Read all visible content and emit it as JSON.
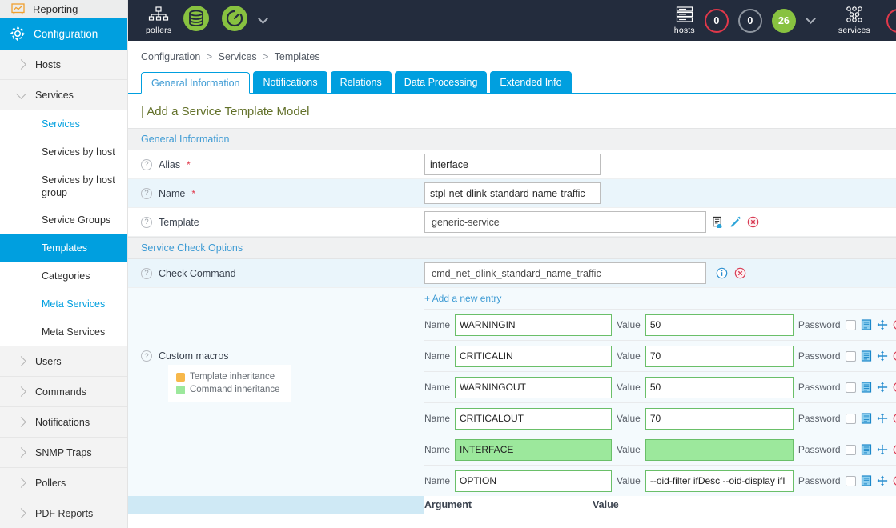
{
  "sidebar": {
    "top_item": {
      "label": "Reporting",
      "icon": "reporting-chart-icon"
    },
    "main_item": {
      "label": "Configuration",
      "icon": "gear-icon"
    },
    "groups": [
      {
        "label": "Hosts",
        "expanded": false
      },
      {
        "label": "Services",
        "expanded": true
      }
    ],
    "sub_items": [
      {
        "label": "Services",
        "state": "link"
      },
      {
        "label": "Services by host",
        "state": "normal"
      },
      {
        "label": "Services by host group",
        "state": "normal"
      },
      {
        "label": "Service Groups",
        "state": "normal"
      },
      {
        "label": "Templates",
        "state": "active"
      },
      {
        "label": "Categories",
        "state": "normal"
      },
      {
        "label": "Meta Services",
        "state": "link"
      },
      {
        "label": "Meta Services",
        "state": "normal"
      }
    ],
    "bottom_groups": [
      {
        "label": "Users"
      },
      {
        "label": "Commands"
      },
      {
        "label": "Notifications"
      },
      {
        "label": "SNMP Traps"
      },
      {
        "label": "Pollers"
      },
      {
        "label": "PDF Reports"
      }
    ]
  },
  "header": {
    "pollers_caption": "pollers",
    "pollers_icon": "pollers-tree-icon",
    "database_icon": "database-icon",
    "gauge_icon": "gauge-icon",
    "left_caret_icon": "chevron-down-icon",
    "hosts_caption": "hosts",
    "hosts_icon": "server-rack-icon",
    "hosts_counters": [
      {
        "value": "0",
        "style": "red"
      },
      {
        "value": "0",
        "style": "grey"
      },
      {
        "value": "26",
        "style": "green"
      }
    ],
    "hosts_caret_icon": "chevron-down-icon",
    "services_caption": "services",
    "services_icon": "services-nodes-icon",
    "colors": {
      "bar": "#232c3d",
      "accent": "#009fdf",
      "green": "#88c240",
      "red": "#e0384a",
      "grey": "#8d949e"
    }
  },
  "content": {
    "breadcrumb": [
      "Configuration",
      "Services",
      "Templates"
    ],
    "breadcrumb_sep": ">",
    "tabs": [
      {
        "label": "General Information",
        "active": true
      },
      {
        "label": "Notifications",
        "active": false
      },
      {
        "label": "Relations",
        "active": false
      },
      {
        "label": "Data Processing",
        "active": false
      },
      {
        "label": "Extended Info",
        "active": false
      }
    ],
    "page_title": "| Add a Service Template Model",
    "sections": {
      "general": {
        "heading": "General Information",
        "fields": {
          "alias": {
            "label": "Alias",
            "required": "*",
            "value": "interface"
          },
          "name": {
            "label": "Name",
            "required": "*",
            "value": "stpl-net-dlink-standard-name-traffic"
          },
          "template": {
            "label": "Template",
            "value": "generic-service",
            "icons": [
              "duplicate-icon",
              "pencil-icon",
              "delete-circle-icon"
            ]
          }
        }
      },
      "service_check": {
        "heading": "Service Check Options",
        "check_command": {
          "label": "Check Command",
          "value": "cmd_net_dlink_standard_name_traffic",
          "icons": [
            "info-circle-icon",
            "delete-circle-icon"
          ]
        },
        "add_entry_label": "+ Add a new entry",
        "custom_macros": {
          "label": "Custom macros",
          "legend": [
            {
              "text": "Template inheritance",
              "color": "#f7b84b"
            },
            {
              "text": "Command inheritance",
              "color": "#9ce89c"
            }
          ],
          "col_name_label": "Name",
          "col_value_label": "Value",
          "password_label": "Password",
          "row_icons": [
            "password-checkbox",
            "note-icon",
            "move-icon",
            "delete-circle-icon"
          ],
          "rows": [
            {
              "name": "WARNINGIN",
              "value": "50",
              "highlight": false
            },
            {
              "name": "CRITICALIN",
              "value": "70",
              "highlight": false
            },
            {
              "name": "WARNINGOUT",
              "value": "50",
              "highlight": false
            },
            {
              "name": "CRITICALOUT",
              "value": "70",
              "highlight": false
            },
            {
              "name": "INTERFACE",
              "value": "",
              "highlight": true
            },
            {
              "name": "OPTION",
              "value": "--oid-filter ifDesc --oid-display ifI",
              "highlight": false
            }
          ]
        },
        "arguments_table": {
          "col_argument": "Argument",
          "col_value": "Value"
        }
      }
    }
  }
}
